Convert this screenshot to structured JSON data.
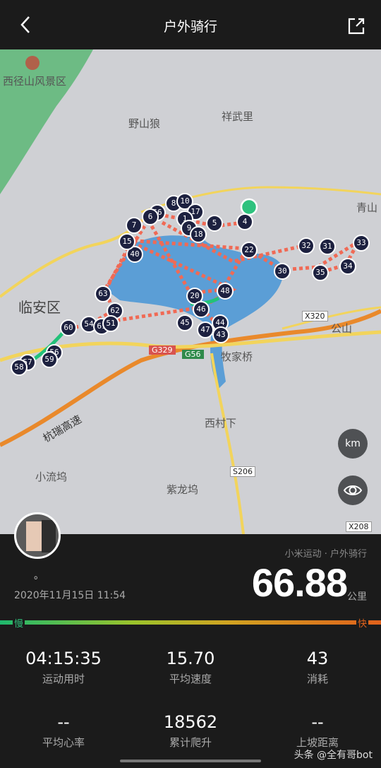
{
  "header": {
    "title": "户外骑行",
    "back_icon": "chevron-left-icon",
    "share_icon": "share-icon"
  },
  "map": {
    "labels": {
      "scenic": "西径山风景区",
      "yeshanlang": "野山狼",
      "xiangwuli": "祥武里",
      "qingshan": "青山",
      "linan": "临安区",
      "gongshan": "公山",
      "mujiaqiao": "牧家桥",
      "xicunxia": "西村下",
      "hangrui": "杭瑞高速",
      "xiaoliuwu": "小流坞",
      "zilongwu": "紫龙坞",
      "x320": "X320",
      "g329": "G329",
      "g56": "G56",
      "s206": "S206",
      "x208": "X208"
    },
    "markers": [
      "4",
      "5",
      "8",
      "10",
      "17",
      "1",
      "9",
      "18",
      "66",
      "6",
      "7",
      "40",
      "15",
      "22",
      "32",
      "31",
      "33",
      "30",
      "35",
      "34",
      "48",
      "20",
      "46",
      "45",
      "47",
      "44",
      "43",
      "63",
      "62",
      "54",
      "61",
      "51",
      "60",
      "56",
      "59",
      "57",
      "58"
    ],
    "km_button": "km",
    "eye_icon": "eye-icon"
  },
  "summary": {
    "source": "小米运动 · 户外骑行",
    "user_name": "。",
    "date": "2020年11月15日 11:54",
    "distance": "66.88",
    "unit": "公里",
    "slow_label": "慢",
    "fast_label": "快"
  },
  "stats": [
    {
      "value": "04:15:35",
      "label": "运动用时"
    },
    {
      "value": "15.70",
      "label": "平均速度"
    },
    {
      "value": "43",
      "label": "消耗"
    },
    {
      "value": "--",
      "label": "平均心率"
    },
    {
      "value": "18562",
      "label": "累计爬升"
    },
    {
      "value": "--",
      "label": "上坡距离"
    }
  ],
  "watermark": "头条 @全有哥bot",
  "colors": {
    "route": "#f06a55",
    "lake": "#5b9ed6",
    "green_area": "#6dbb84",
    "highway": "#e9892b",
    "road": "#f2d45c",
    "start_dot": "#2ec27e"
  }
}
